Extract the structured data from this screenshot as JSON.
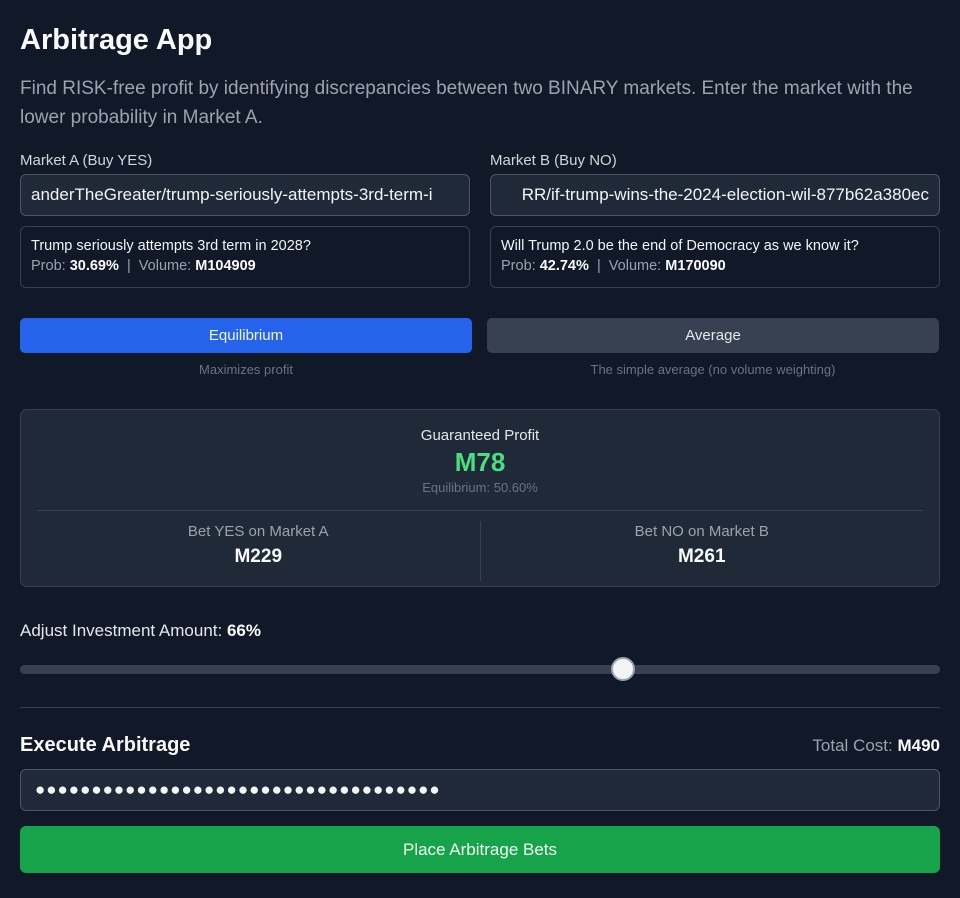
{
  "app": {
    "title": "Arbitrage App",
    "subtitle": "Find RISK-free profit by identifying discrepancies between two BINARY markets. Enter the market with the lower probability in Market A."
  },
  "market_a": {
    "label": "Market A (Buy YES)",
    "input_value": "anderTheGreater/trump-seriously-attempts-3rd-term-i",
    "question": "Trump seriously attempts 3rd term in 2028?",
    "prob_label": "Prob:",
    "prob": "30.69%",
    "separator": "|",
    "volume_label": "Volume:",
    "volume": "M104909"
  },
  "market_b": {
    "label": "Market B (Buy NO)",
    "input_value": "RR/if-trump-wins-the-2024-election-wil-877b62a380ec",
    "question": "Will Trump 2.0 be the end of Democracy as we know it?",
    "prob_label": "Prob:",
    "prob": "42.74%",
    "separator": "|",
    "volume_label": "Volume:",
    "volume": "M170090"
  },
  "modes": {
    "equilibrium": {
      "label": "Equilibrium",
      "desc": "Maximizes profit",
      "active": true
    },
    "average": {
      "label": "Average",
      "desc": "The simple average (no volume weighting)",
      "active": false
    }
  },
  "profit": {
    "label": "Guaranteed Profit",
    "value": "M78",
    "equilibrium": "Equilibrium: 50.60%",
    "bet_yes_label": "Bet YES on Market A",
    "bet_yes_value": "M229",
    "bet_no_label": "Bet NO on Market B",
    "bet_no_value": "M261"
  },
  "investment": {
    "label": "Adjust Investment Amount:",
    "value_text": "66%",
    "fraction": 0.66
  },
  "execute": {
    "title": "Execute Arbitrage",
    "total_label": "Total Cost:",
    "total_value": "M490",
    "api_key_masked": "●●●●●●●●●●●●●●●●●●●●●●●●●●●●●●●●●●●●",
    "place_label": "Place Arbitrage Bets"
  },
  "colors": {
    "background": "#111827",
    "primary": "#2563eb",
    "profit": "#4ade80",
    "success": "#16a34a"
  }
}
